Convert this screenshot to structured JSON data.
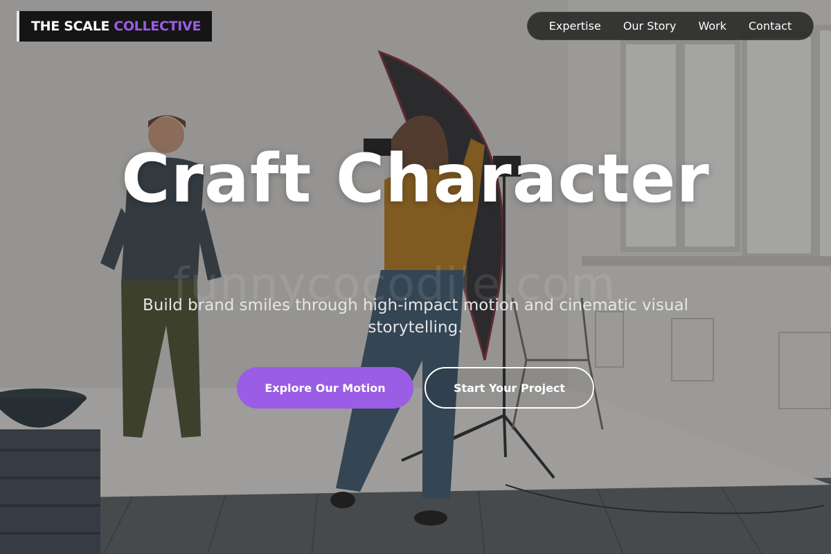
{
  "header": {
    "logo_main": "THE SCALE",
    "logo_accent": "COLLECTIVE",
    "nav": [
      "Expertise",
      "Our Story",
      "Work",
      "Contact"
    ]
  },
  "hero": {
    "title": "Craft Character",
    "subtitle": "Build brand smiles through high-impact motion and cinematic visual storytelling.",
    "primary_button": "Explore Our Motion",
    "secondary_button": "Start Your Project",
    "watermark": "funnycocodile.com"
  },
  "colors": {
    "accent": "#9b5de5",
    "logo_bg": "#151515",
    "nav_bg": "#1e1e1e"
  },
  "background": {
    "icon": "photo-studio-scene"
  }
}
